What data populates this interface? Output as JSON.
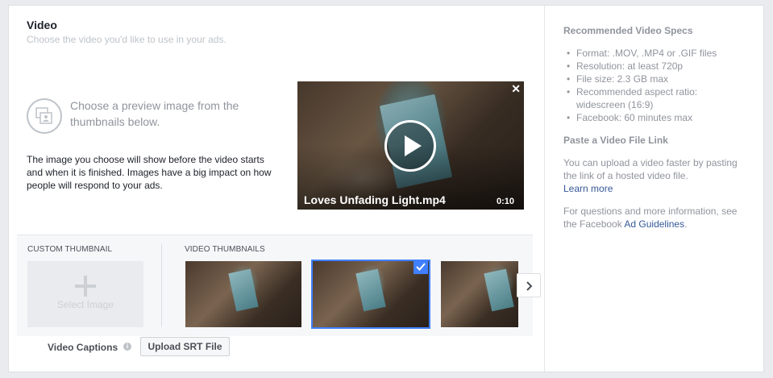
{
  "main": {
    "title": "Video",
    "subtitle": "Choose the video you'd like to use in your ads.",
    "preview_title": "Choose a preview image from the thumbnails below.",
    "preview_description": "The image you choose will show before the video starts and when it is finished. Images have a big impact on how people will respond to your ads.",
    "video": {
      "filename": "Loves Unfading Light.mp4",
      "duration": "0:10",
      "close_icon": "close-icon",
      "play_icon": "play-icon"
    },
    "thumbnails": {
      "custom_label": "CUSTOM THUMBNAIL",
      "custom_button": "Select Image",
      "video_label": "VIDEO THUMBNAILS",
      "selected_index": 1,
      "accent_color": "#4080ff"
    },
    "captions": {
      "label": "Video Captions",
      "info_icon": "info-icon",
      "upload_button": "Upload SRT File"
    }
  },
  "sidebar": {
    "specs_title": "Recommended Video Specs",
    "specs": [
      "Format: .MOV, .MP4 or .GIF files",
      "Resolution: at least 720p",
      "File size: 2.3 GB max",
      "Recommended aspect ratio:",
      "widescreen (16:9)",
      "Facebook: 60 minutes max"
    ],
    "paste_title": "Paste a Video File Link",
    "paste_text": "You can upload a video faster by pasting the link of a hosted video file.",
    "learn_more": "Learn more",
    "guidelines_text": "For questions and more information, see the Facebook ",
    "guidelines_link": "Ad Guidelines",
    "guidelines_end": ".",
    "link_color": "#365899"
  }
}
